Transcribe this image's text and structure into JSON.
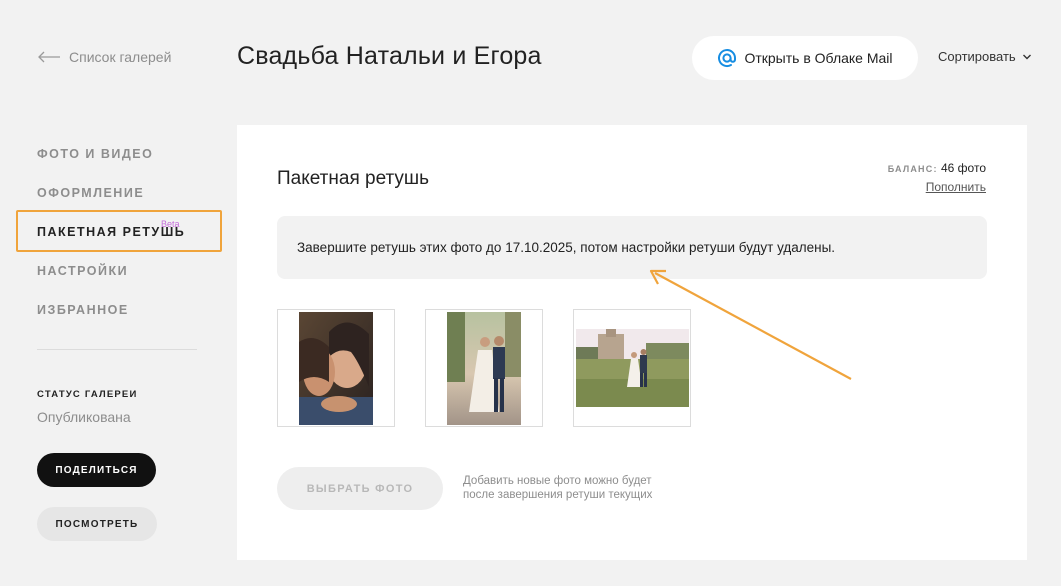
{
  "header": {
    "back_label": "Список галерей",
    "title": "Свадьба Натальи и Егора",
    "cloud_button_label": "Открыть в Облаке Mail",
    "sort_label": "Сортировать"
  },
  "sidebar": {
    "items": [
      {
        "label": "ФОТО И ВИДЕО"
      },
      {
        "label": "ОФОРМЛЕНИЕ"
      },
      {
        "label": "ПАКЕТНАЯ РЕТУШЬ",
        "badge": "Beta"
      },
      {
        "label": "НАСТРОЙКИ"
      },
      {
        "label": "ИЗБРАННОЕ"
      }
    ],
    "status_label": "СТАТУС ГАЛЕРЕИ",
    "status_value": "Опубликована",
    "share_label": "ПОДЕЛИТЬСЯ",
    "view_label": "ПОСМОТРЕТЬ"
  },
  "main": {
    "title": "Пакетная ретушь",
    "balance_label": "БАЛАНС:",
    "balance_value": "46 фото",
    "topup_label": "Пополнить",
    "notice": "Завершите ретушь этих фото до 17.10.2025, потом настройки ретуши будут удалены.",
    "photos": [
      {
        "icon": "couple-closeup-photo"
      },
      {
        "icon": "couple-walking-photo"
      },
      {
        "icon": "couple-field-photo"
      }
    ],
    "pick_label": "ВЫБРАТЬ ФОТО",
    "pick_hint": "Добавить новые фото можно будет после завершения ретуши текущих"
  },
  "colors": {
    "accent_highlight": "#f0a43c",
    "beta_badge": "#c46cd9",
    "mail_blue": "#168de2"
  }
}
